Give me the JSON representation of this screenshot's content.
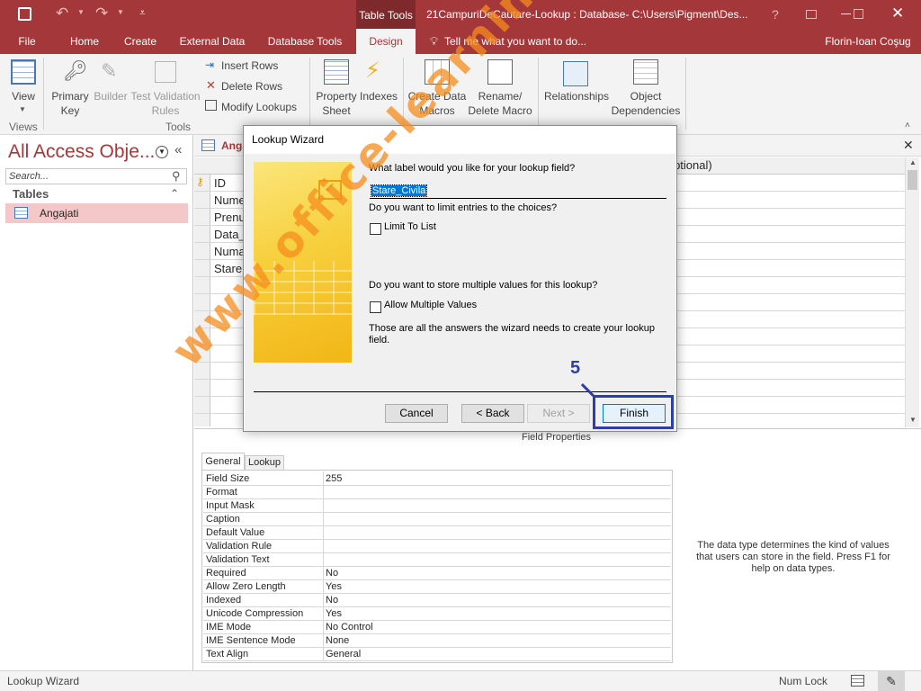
{
  "titlebar": {
    "context_tab": "Table Tools",
    "title": "21CampuriDeCautare-Lookup : Database- C:\\Users\\Pigment\\Des...",
    "help": "?",
    "user": "Florin-Ioan Coşug"
  },
  "menu": {
    "file": "File",
    "home": "Home",
    "create": "Create",
    "external": "External Data",
    "dbtools": "Database Tools",
    "design": "Design",
    "tellme": "Tell me what you want to do..."
  },
  "ribbon": {
    "view": "View",
    "views_group": "Views",
    "primary_key_1": "Primary",
    "primary_key_2": "Key",
    "builder": "Builder",
    "test_validation_1": "Test Validation",
    "test_validation_2": "Rules",
    "insert_rows": "Insert Rows",
    "delete_rows": "Delete Rows",
    "modify_lookups": "Modify Lookups",
    "tools_group": "Tools",
    "property_sheet_1": "Property",
    "property_sheet_2": "Sheet",
    "indexes": "Indexes",
    "create_data_macros_1": "Create Data",
    "create_data_macros_2": "Macros",
    "rename_macro_1": "Rename/",
    "rename_macro_2": "Delete Macro",
    "relationships": "Relationships",
    "object_dependencies_1": "Object",
    "object_dependencies_2": "Dependencies"
  },
  "nav": {
    "header": "All Access Obje...",
    "search_placeholder": "Search...",
    "tables_label": "Tables",
    "items": [
      "Angajati"
    ]
  },
  "table": {
    "tab_label": "Angajati",
    "description_header": "Description (Optional)",
    "fields": [
      "ID",
      "Nume",
      "Prenume",
      "Data_",
      "Numar",
      "Stare"
    ]
  },
  "field_props": {
    "caption": "Field Properties",
    "tab_general": "General",
    "tab_lookup": "Lookup",
    "rows": [
      {
        "name": "Field Size",
        "value": "255"
      },
      {
        "name": "Format",
        "value": ""
      },
      {
        "name": "Input Mask",
        "value": ""
      },
      {
        "name": "Caption",
        "value": ""
      },
      {
        "name": "Default Value",
        "value": ""
      },
      {
        "name": "Validation Rule",
        "value": ""
      },
      {
        "name": "Validation Text",
        "value": ""
      },
      {
        "name": "Required",
        "value": "No"
      },
      {
        "name": "Allow Zero Length",
        "value": "Yes"
      },
      {
        "name": "Indexed",
        "value": "No"
      },
      {
        "name": "Unicode Compression",
        "value": "Yes"
      },
      {
        "name": "IME Mode",
        "value": "No Control"
      },
      {
        "name": "IME Sentence Mode",
        "value": "None"
      },
      {
        "name": "Text Align",
        "value": "General"
      }
    ],
    "help_text": "The data type determines the kind of values that users can store in the field. Press F1 for help on data types."
  },
  "dialog": {
    "title": "Lookup Wizard",
    "q_label": "What label would you like for your lookup field?",
    "label_value": "Stare_Civila",
    "q_limit": "Do you want to limit entries to the choices?",
    "limit_to_list": "Limit To List",
    "q_multiple": "Do you want to store multiple values for this lookup?",
    "allow_multiple": "Allow Multiple Values",
    "summary": "Those are all the answers the wizard needs to create your lookup field.",
    "cancel": "Cancel",
    "back": "< Back",
    "next": "Next >",
    "finish": "Finish",
    "step_marker": "5"
  },
  "status": {
    "left": "Lookup Wizard",
    "num_lock": "Num Lock"
  },
  "watermark": "www.office-learning.ro",
  "colors": {
    "accent": "#a4373a",
    "highlight_box": "#2e3fa3",
    "watermark": "#f58c1e"
  }
}
